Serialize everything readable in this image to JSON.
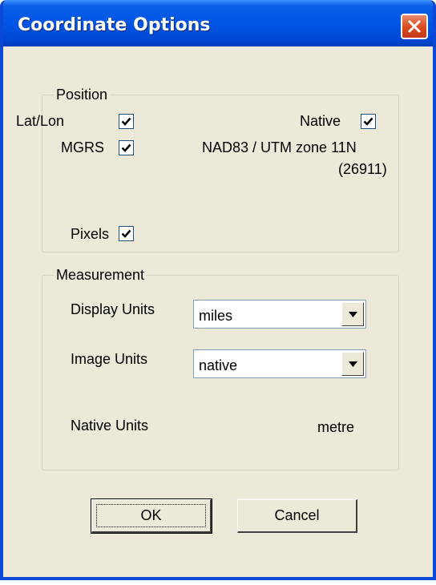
{
  "window": {
    "title": "Coordinate Options"
  },
  "position": {
    "legend": "Position",
    "latlon": {
      "label": "Lat/Lon",
      "checked": true
    },
    "mgrs": {
      "label": "MGRS",
      "checked": true
    },
    "native": {
      "label": "Native",
      "checked": true
    },
    "projection_line1": "NAD83 / UTM zone 11N",
    "projection_line2": "(26911)",
    "pixels": {
      "label": "Pixels",
      "checked": true
    }
  },
  "measurement": {
    "legend": "Measurement",
    "display_units_label": "Display Units",
    "display_units_value": "miles",
    "image_units_label": "Image Units",
    "image_units_value": "native",
    "native_units_label": "Native Units",
    "native_units_value": "metre"
  },
  "buttons": {
    "ok": "OK",
    "cancel": "Cancel"
  },
  "colors": {
    "titlebar": "#0055e5",
    "dialog_bg": "#ece9d8",
    "close_button": "#d94a1d"
  },
  "icons": {
    "close": "close-icon",
    "checkbox_check": "check-icon",
    "dropdown": "dropdown-arrow-icon"
  }
}
